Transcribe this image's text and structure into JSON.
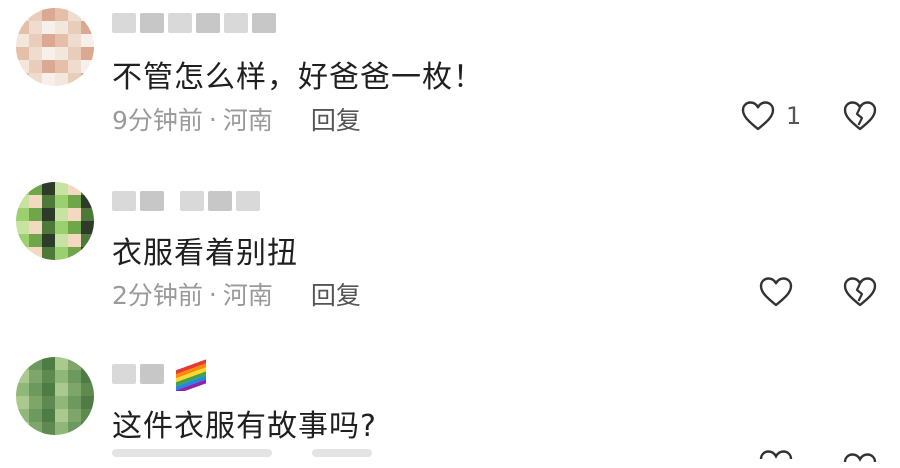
{
  "comments": [
    {
      "username": "",
      "text": "不管怎么样，好爸爸一枚！",
      "time": "9分钟前",
      "location": "河南",
      "reply_label": "回复",
      "like_count": "1",
      "avatar_colors": [
        "#f3e6dd",
        "#e9cdbb",
        "#dba891",
        "#e6bfa9",
        "#f0dccf",
        "#f7efe9"
      ]
    },
    {
      "username": "",
      "text": "衣服看着别扭",
      "time": "2分钟前",
      "location": "河南",
      "reply_label": "回复",
      "like_count": "",
      "avatar_colors": [
        "#9ccf6f",
        "#6fa64a",
        "#2f3b2a",
        "#c8e39f",
        "#f3d9c0",
        "#4e7a39"
      ]
    },
    {
      "username": "",
      "text": "这件衣服有故事吗?",
      "time": "",
      "location": "",
      "reply_label": "",
      "like_count": "",
      "avatar_colors": [
        "#8fb77a",
        "#6c9a5e",
        "#4f7b44",
        "#a9c98e",
        "#7ea66a",
        "#5e8a50"
      ]
    }
  ],
  "separator": "·",
  "colors": {
    "meta": "#9a9a9a",
    "text": "#1f1f1f",
    "icon": "#333333"
  },
  "icons": {
    "like": "heart-outline-icon",
    "dislike": "broken-heart-icon"
  }
}
